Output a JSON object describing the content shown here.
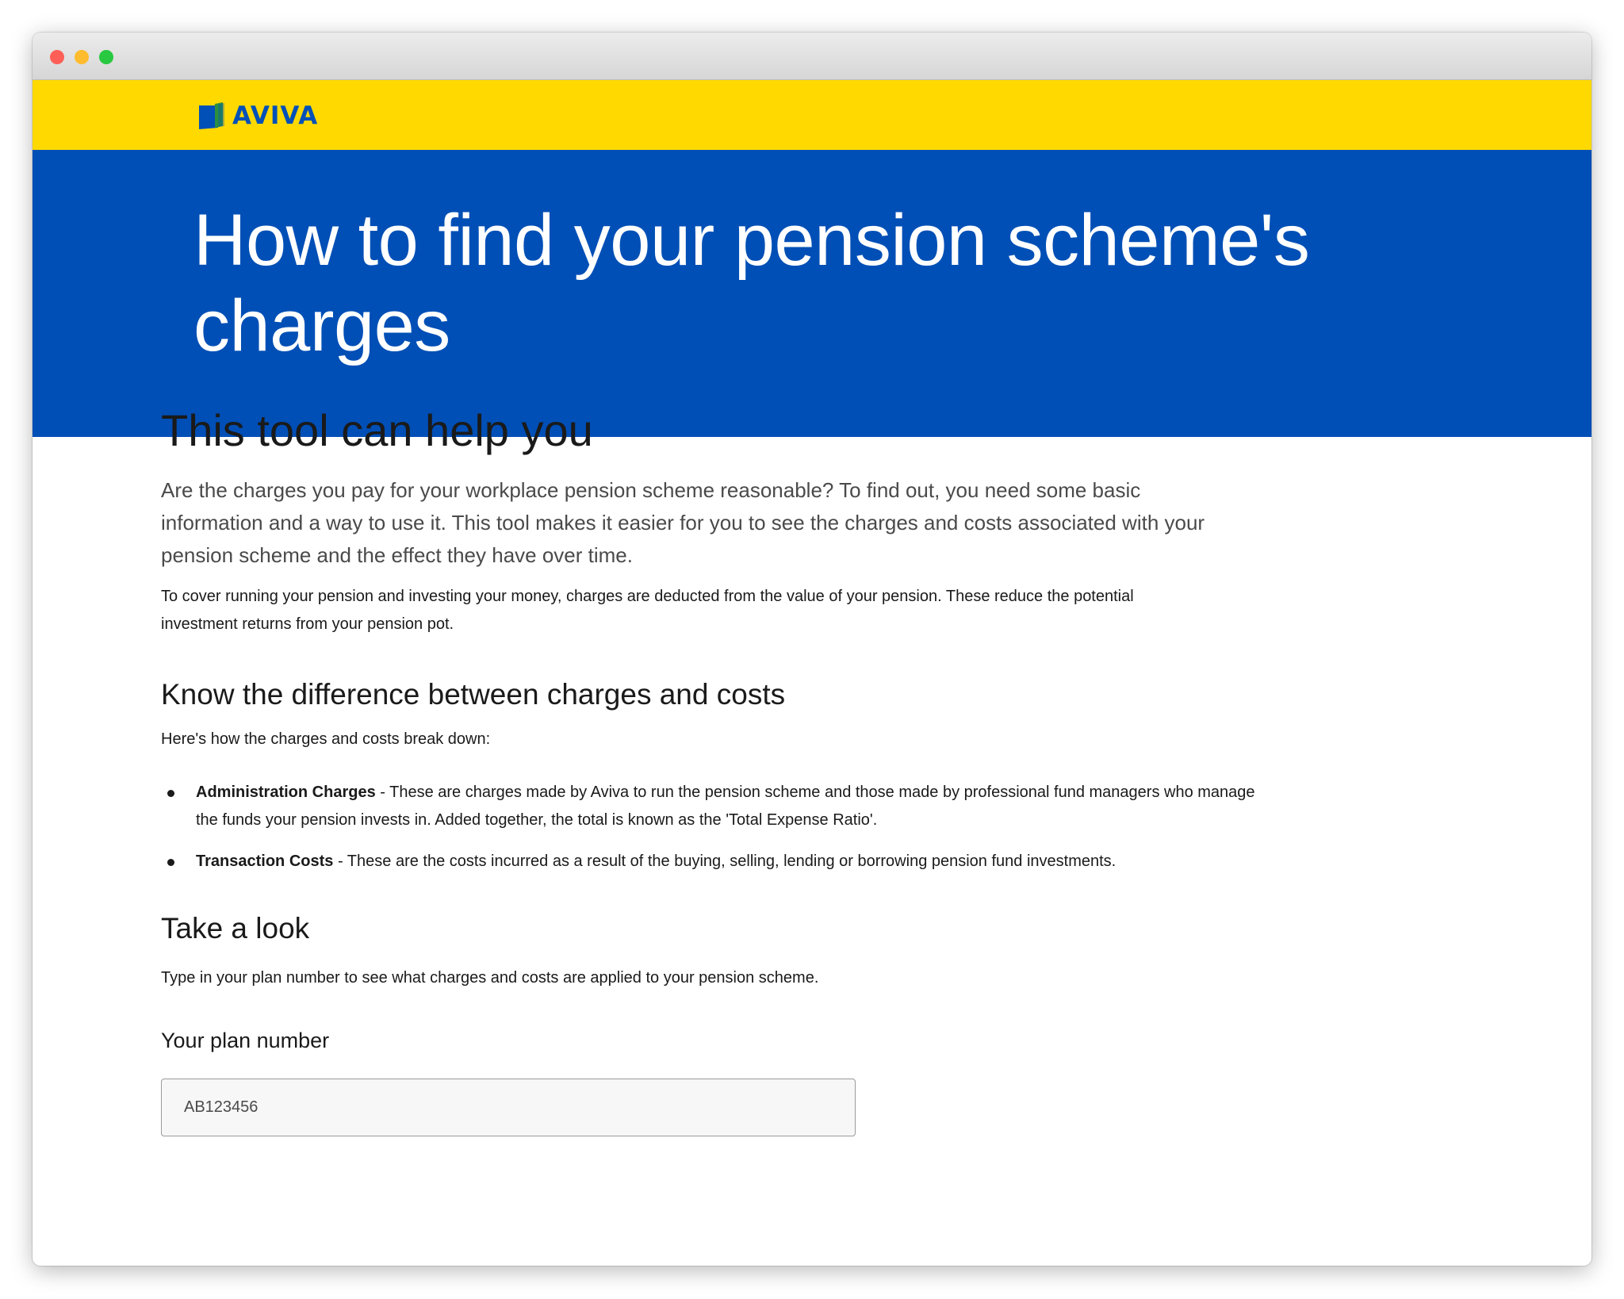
{
  "brand": {
    "logo_text": "AVIVA",
    "yellow": "#ffd900",
    "blue": "#004fb6"
  },
  "hero": {
    "title": "How to find your pension scheme's charges"
  },
  "intro": {
    "heading": "This tool can help you",
    "lead": "Are the charges you pay for your workplace pension scheme reasonable? To find out, you need some basic information and a way to use it. This tool makes it easier for you to see the charges and costs associated with your pension scheme and the effect they have over time.",
    "paragraph": "To cover running your pension and investing your money, charges are deducted from the value of your pension. These reduce the potential investment returns from your pension pot."
  },
  "difference": {
    "heading": "Know the difference between charges and costs",
    "intro": "Here's how the charges and costs break down:",
    "items": [
      {
        "term": "Administration Charges",
        "text": " - These are charges made by Aviva to run the pension scheme and those made by professional fund managers who manage the funds your pension invests in. Added together, the total is known as the 'Total Expense Ratio'."
      },
      {
        "term": "Transaction Costs",
        "text": " - These are the costs incurred as a result of the buying, selling, lending or borrowing pension fund investments."
      }
    ]
  },
  "look": {
    "heading": "Take a look",
    "text": "Type in your plan number to see what charges and costs are applied to your pension scheme.",
    "field_label": "Your plan number",
    "field_placeholder": "AB123456"
  }
}
